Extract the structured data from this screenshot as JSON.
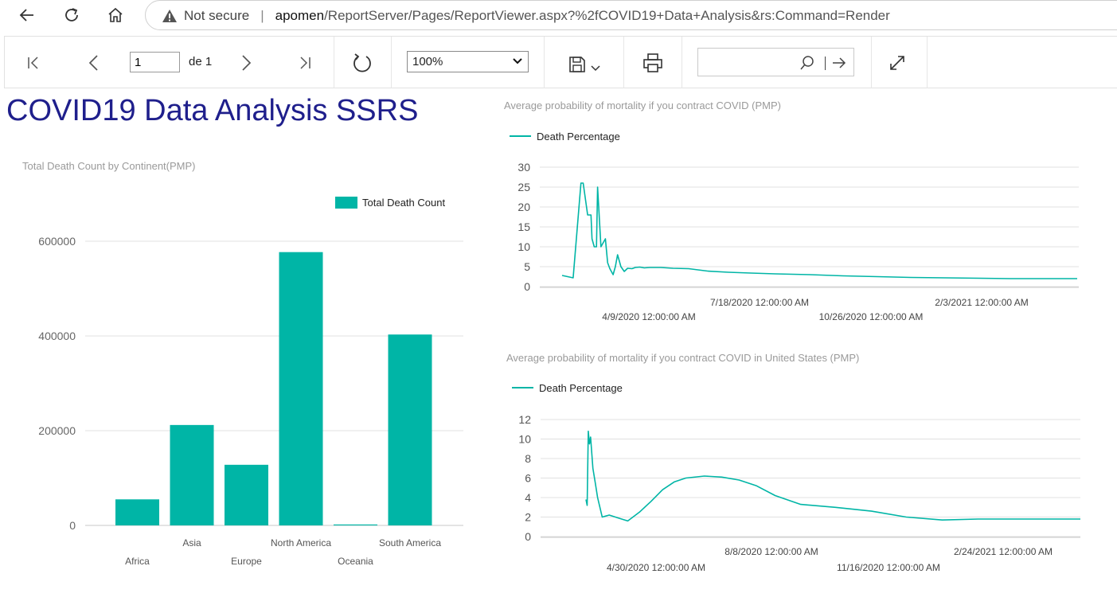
{
  "browser": {
    "security_label": "Not secure",
    "url_host": "apomen",
    "url_path": "/ReportServer/Pages/ReportViewer.aspx?%2fCOVID19+Data+Analysis&rs:Command=Render"
  },
  "toolbar": {
    "page_number": "1",
    "page_of": "de 1",
    "zoom": "100%",
    "find_placeholder": ""
  },
  "report": {
    "title": "COVID19 Data Analysis SSRS"
  },
  "colors": {
    "series": "#00b5a6",
    "title": "#1f1f8c"
  },
  "icons": [
    "back-arrow-icon",
    "refresh-icon",
    "home-icon",
    "warning-icon",
    "first-page-icon",
    "previous-page-icon",
    "next-page-icon",
    "last-page-icon",
    "refresh-report-icon",
    "save-icon",
    "chevron-down-icon",
    "print-icon",
    "search-icon",
    "find-next-icon",
    "expand-icon"
  ],
  "chart_data": [
    {
      "type": "bar",
      "title": "Total Death Count by Continent(PMP)",
      "legend": "Total Death Count",
      "legend_position": "top-right",
      "categories": [
        "Africa",
        "Asia",
        "Europe",
        "North America",
        "Oceania",
        "South America"
      ],
      "values": [
        55000,
        212000,
        128000,
        577000,
        2000,
        403000
      ],
      "ylim": [
        0,
        650000
      ],
      "yticks": [
        "0",
        "200000",
        "400000",
        "600000"
      ],
      "grid": true
    },
    {
      "type": "line",
      "title": "Average probability of mortality if you contract COVID (PMP)",
      "legend": "Death Percentage",
      "legend_position": "top-left",
      "ylim": [
        0,
        30
      ],
      "yticks": [
        "0",
        "5",
        "10",
        "15",
        "20",
        "25",
        "30"
      ],
      "xtick_labels_row1": [
        "7/18/2020 12:00:00 AM",
        "2/3/2021 12:00:00 AM"
      ],
      "xtick_labels_row2": [
        "4/9/2020 12:00:00 AM",
        "10/26/2020 12:00:00 AM"
      ],
      "x": [
        "2020-01-22",
        "2020-02-01",
        "2020-02-08",
        "2020-02-10",
        "2020-02-14",
        "2020-02-17",
        "2020-02-18",
        "2020-02-20",
        "2020-02-22",
        "2020-02-23",
        "2020-02-26",
        "2020-03-01",
        "2020-03-03",
        "2020-03-05",
        "2020-03-08",
        "2020-03-10",
        "2020-03-12",
        "2020-03-15",
        "2020-03-18",
        "2020-03-21",
        "2020-03-25",
        "2020-03-28",
        "2020-04-01",
        "2020-04-05",
        "2020-04-10",
        "2020-04-20",
        "2020-05-01",
        "2020-05-15",
        "2020-06-01",
        "2020-06-20",
        "2020-07-10",
        "2020-08-01",
        "2020-09-01",
        "2020-10-01",
        "2020-11-01",
        "2020-12-01",
        "2021-01-01",
        "2021-02-01",
        "2021-03-01",
        "2021-04-01",
        "2021-04-30"
      ],
      "y": [
        2.8,
        2.2,
        26,
        26,
        18,
        18,
        12,
        10,
        10,
        25,
        10,
        12,
        6,
        4.5,
        3,
        5,
        8,
        5,
        3.8,
        4.6,
        4.5,
        4.8,
        4.9,
        4.7,
        4.8,
        4.8,
        4.6,
        4.5,
        3.9,
        3.6,
        3.4,
        3.2,
        3.0,
        2.7,
        2.5,
        2.3,
        2.2,
        2.1,
        2.0,
        2.0,
        2.0
      ],
      "grid": true
    },
    {
      "type": "line",
      "title": "Average probability of mortality if you contract COVID in United States (PMP)",
      "legend": "Death Percentage",
      "legend_position": "top-left",
      "ylim": [
        0,
        12
      ],
      "yticks": [
        "0",
        "2",
        "4",
        "6",
        "8",
        "10",
        "12"
      ],
      "xtick_labels_row1": [
        "8/8/2020 12:00:00 AM",
        "2/24/2021 12:00:00 AM"
      ],
      "xtick_labels_row2": [
        "4/30/2020 12:00:00 AM",
        "11/16/2020 12:00:00 AM"
      ],
      "x": [
        "2020-02-29",
        "2020-03-01",
        "2020-03-02",
        "2020-03-03",
        "2020-03-04",
        "2020-03-06",
        "2020-03-08",
        "2020-03-10",
        "2020-03-14",
        "2020-03-20",
        "2020-03-28",
        "2020-04-05",
        "2020-04-15",
        "2020-04-25",
        "2020-05-05",
        "2020-05-15",
        "2020-05-25",
        "2020-06-10",
        "2020-06-25",
        "2020-07-10",
        "2020-07-25",
        "2020-08-10",
        "2020-09-01",
        "2020-10-01",
        "2020-11-01",
        "2020-12-01",
        "2021-01-01",
        "2021-02-01",
        "2021-03-01",
        "2021-04-01",
        "2021-04-30"
      ],
      "y": [
        3.8,
        3.2,
        10.8,
        9.5,
        10.2,
        7,
        5.5,
        4,
        2,
        2.2,
        1.9,
        1.6,
        2.5,
        3.6,
        4.8,
        5.6,
        6.0,
        6.2,
        6.1,
        5.8,
        5.2,
        4.2,
        3.3,
        3.0,
        2.6,
        2.0,
        1.7,
        1.8,
        1.8,
        1.8,
        1.8
      ],
      "grid": true
    }
  ]
}
